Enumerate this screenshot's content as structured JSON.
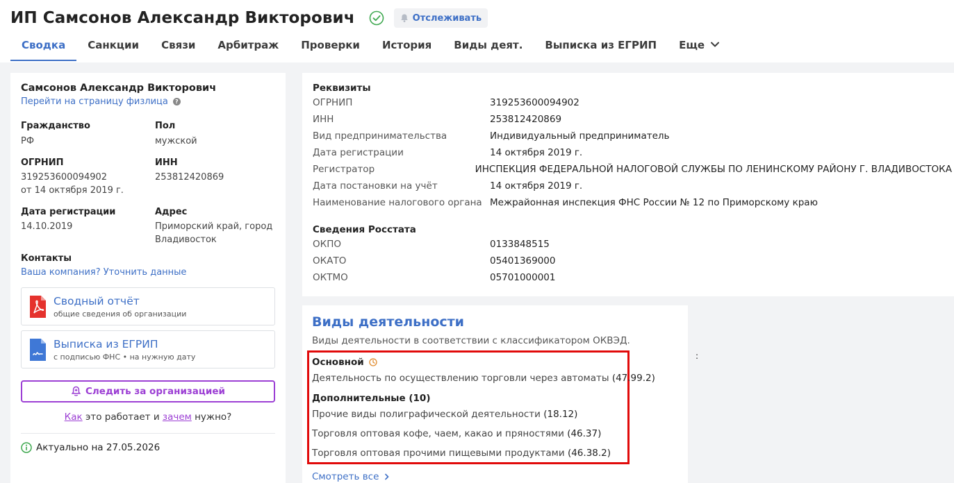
{
  "header": {
    "title": "ИП Самсонов Александр Викторович",
    "track_label": "Отслеживать",
    "tabs": [
      {
        "label": "Сводка"
      },
      {
        "label": "Санкции"
      },
      {
        "label": "Связи"
      },
      {
        "label": "Арбитраж"
      },
      {
        "label": "Проверки"
      },
      {
        "label": "История"
      },
      {
        "label": "Виды деят."
      },
      {
        "label": "Выписка из ЕГРИП"
      },
      {
        "label": "Еще"
      }
    ]
  },
  "summary": {
    "name": "Самсонов Александр Викторович",
    "person_link": "Перейти на страницу физлица",
    "citizenship_label": "Гражданство",
    "citizenship_value": "РФ",
    "gender_label": "Пол",
    "gender_value": "мужской",
    "ogrnip_label": "ОГРНИП",
    "ogrnip_value": "319253600094902",
    "ogrnip_date": "от 14 октября 2019 г.",
    "inn_label": "ИНН",
    "inn_value": "253812420869",
    "regdate_label": "Дата регистрации",
    "regdate_value": "14.10.2019",
    "address_label": "Адрес",
    "address_value": "Приморский край, город Владивосток",
    "contacts_label": "Контакты",
    "contacts_link": "Ваша компания? Уточнить данные",
    "report_title": "Сводный отчёт",
    "report_sub": "общие сведения об организации",
    "extract_title": "Выписка из ЕГРИП",
    "extract_sub": "с подписью ФНС • на нужную дату",
    "follow_label": "Следить за организацией",
    "how_link": "Как",
    "how_text": "это работает и",
    "why_link": "зачем",
    "why_text": "нужно?",
    "actual": "Актуально на 27.05.2026"
  },
  "requisites": {
    "title": "Реквизиты",
    "rows": [
      {
        "k": "ОГРНИП",
        "v": "319253600094902"
      },
      {
        "k": "ИНН",
        "v": "253812420869"
      },
      {
        "k": "Вид предпринимательства",
        "v": "Индивидуальный предприниматель"
      },
      {
        "k": "Дата регистрации",
        "v": "14 октября 2019 г."
      },
      {
        "k": "Регистратор",
        "v": "ИНСПЕКЦИЯ ФЕДЕРАЛЬНОЙ НАЛОГОВОЙ СЛУЖБЫ ПО ЛЕНИНСКОМУ РАЙОНУ Г. ВЛАДИВОСТОКА"
      },
      {
        "k": "Дата постановки на учёт",
        "v": "14 октября 2019 г."
      },
      {
        "k": "Наименование налогового органа",
        "v": "Межрайонная инспекция ФНС России № 12 по Приморскому краю"
      }
    ],
    "rosstat_title": "Сведения Росстата",
    "rosstat_rows": [
      {
        "k": "ОКПО",
        "v": "0133848515"
      },
      {
        "k": "ОКАТО",
        "v": "05401369000"
      },
      {
        "k": "ОКТМО",
        "v": "05701000001"
      }
    ]
  },
  "activities": {
    "title": "Виды деятельности",
    "desc": "Виды деятельности в соответствии с классификатором ОКВЭД.",
    "main_label": "Основной",
    "main_item": "Деятельность по осуществлению торговли через автоматы",
    "main_code": "(47.99.2)",
    "additional_label": "Дополнительные (10)",
    "items": [
      {
        "text": "Прочие виды полиграфической деятельности",
        "code": "(18.12)"
      },
      {
        "text": "Торговля оптовая кофе, чаем, какао и пряностями",
        "code": "(46.37)"
      },
      {
        "text": "Торговля оптовая прочими пищевыми продуктами",
        "code": "(46.38.2)"
      }
    ],
    "see_all": "Смотреть все",
    "side_mark": ":"
  }
}
